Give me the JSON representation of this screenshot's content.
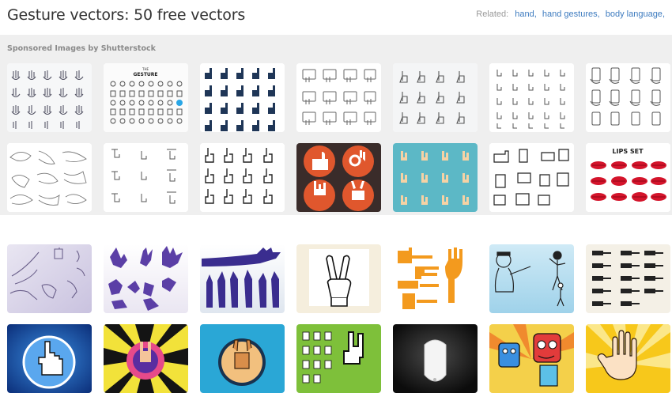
{
  "header": {
    "title": "Gesture vectors: 50 free vectors",
    "related_label": "Related:",
    "related_links": [
      "hand",
      "hand gestures",
      "body language"
    ]
  },
  "sponsored": {
    "label": "Sponsored Images by Shutterstock",
    "row1": [
      {
        "icon": "hand-gesture-outline-grid"
      },
      {
        "icon": "gesture-icon-sheet",
        "text": "THE\nGESTURE"
      },
      {
        "icon": "dark-touch-gesture-icons"
      },
      {
        "icon": "tablet-hand-gesture-icons"
      },
      {
        "icon": "touch-gesture-outline-icons"
      },
      {
        "icon": "small-gesture-icon-grid"
      },
      {
        "icon": "phone-in-hand-icons"
      }
    ],
    "row2": [
      {
        "icon": "sketched-hands"
      },
      {
        "icon": "touch-swipe-icons"
      },
      {
        "icon": "pointing-hand-cursor-icons"
      },
      {
        "icon": "flat-hand-sign-circles"
      },
      {
        "icon": "teal-hand-gestures"
      },
      {
        "icon": "cartoon-gloved-hands"
      },
      {
        "icon": "lips-set",
        "text": "LIPS SET"
      }
    ]
  },
  "gallery": {
    "row1": [
      {
        "icon": "sign-language-hands"
      },
      {
        "icon": "purple-hand-silhouettes"
      },
      {
        "icon": "raised-arms-silhouettes"
      },
      {
        "icon": "peace-sign-hand"
      },
      {
        "icon": "orange-hand-shapes"
      },
      {
        "icon": "blue-figures-illustration"
      },
      {
        "icon": "vintage-pointing-hands"
      }
    ],
    "row2": [
      {
        "icon": "pixel-hand-cursor-badge"
      },
      {
        "icon": "rock-hand-sunburst"
      },
      {
        "icon": "devil-horns-hand"
      },
      {
        "icon": "pixel-hand-icons-green"
      },
      {
        "icon": "white-mouse"
      },
      {
        "icon": "cartoon-monsters"
      },
      {
        "icon": "open-hand-sunburst"
      }
    ]
  },
  "colors": {
    "link": "#3d7bbf",
    "sponsored_bg": "#efefef",
    "tile_purple": "#5b3fa6",
    "tile_orange": "#f39a1e",
    "tile_lips_red": "#d4142b"
  }
}
